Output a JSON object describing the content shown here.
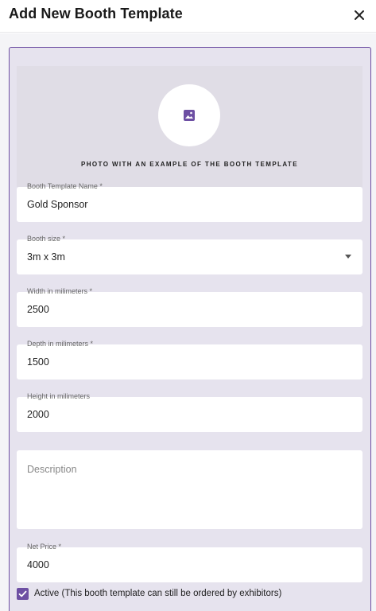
{
  "header": {
    "title": "Add New Booth Template",
    "close_icon": "close-icon"
  },
  "photo": {
    "icon": "image-icon",
    "caption": "PHOTO WITH AN EXAMPLE OF THE BOOTH TEMPLATE"
  },
  "fields": {
    "name": {
      "label": "Booth Template Name *",
      "value": "Gold Sponsor"
    },
    "size": {
      "label": "Booth size *",
      "value": "3m x 3m"
    },
    "width": {
      "label": "Width in milimeters *",
      "value": "2500"
    },
    "depth": {
      "label": "Depth in milimeters *",
      "value": "1500"
    },
    "height": {
      "label": "Height in milimeters",
      "value": "2000"
    },
    "description": {
      "placeholder": "Description",
      "value": ""
    },
    "price": {
      "label": "Net Price *",
      "value": "4000"
    }
  },
  "active": {
    "checked": true,
    "label": "Active (This booth template can still be ordered by exhibitors)"
  },
  "colors": {
    "accent": "#6d4fa3",
    "panel": "#e6e3ee",
    "photo_area": "#e0dde6"
  }
}
